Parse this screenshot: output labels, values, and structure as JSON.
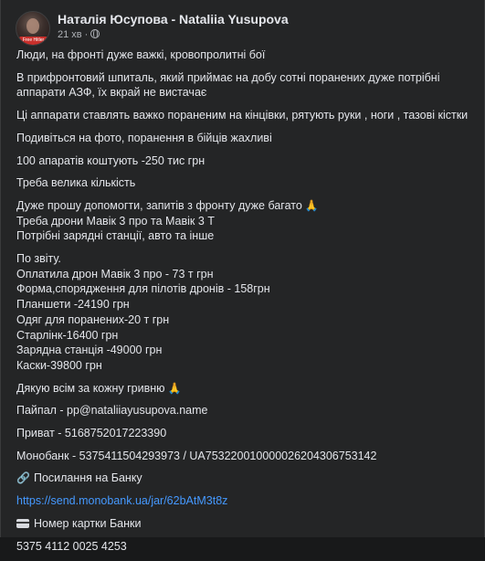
{
  "post": {
    "author": "Наталія Юсупова - Nataliia Yusupova",
    "time": "21 хв",
    "separator": "·",
    "avatar_badge": "Free Hitler"
  },
  "paragraphs": [
    [
      "Люди, на фронті дуже важкі, кровопролитні бої"
    ],
    [
      "В прифронтовий шпиталь, який приймає на добу сотні поранених дуже потрібні",
      "аппарати АЗФ, їх вкрай не вистачає"
    ],
    [
      "Ці аппарати ставлять важко пораненим на кінцівки, рятують руки , ноги , тазові кістки"
    ],
    [
      "Подивіться на фото, поранення в бійців жахливі"
    ],
    [
      "100 апаратів коштують -250 тис грн"
    ],
    [
      "Треба велика кількість"
    ],
    [
      "Дуже прошу допомогти, запитів з фронту дуже багато",
      "Треба дрони Мавік 3 про та Мавік 3 Т",
      "Потрібні зарядні станції, авто та інше"
    ],
    [
      "По звіту.",
      "Оплатила дрон Мавік 3 про - 73 т грн",
      "Форма,спорядження для пілотів дронів - 158грн",
      "Планшети -24190 грн",
      "Одяг для поранених-20 т грн",
      "Старлінк-16400 грн",
      "Зарядна станція -49000 грн",
      "Каски-39800 грн"
    ],
    [
      "Дякую всім за кожну гривню"
    ],
    [
      "Пайпал - pp@nataliiayusupova.name"
    ],
    [
      "Приват - 5168752017223390"
    ],
    [
      "Монобанк - 5375411504293973 / UA753220010000026204306753142"
    ]
  ],
  "bank_link": {
    "label": "Посилання на Банку",
    "url": "https://send.monobank.ua/jar/62bAtM3t8z"
  },
  "card": {
    "label": "Номер картки Банки",
    "number": "5375 4112 0025 4253"
  },
  "icons": {
    "pray": "folded-hands",
    "link": "chain-link",
    "card": "credit-card",
    "audience": "globe"
  },
  "colors": {
    "background": "#242526",
    "text": "#e4e6eb",
    "secondary": "#b0b3b8",
    "link": "#4599ff"
  }
}
